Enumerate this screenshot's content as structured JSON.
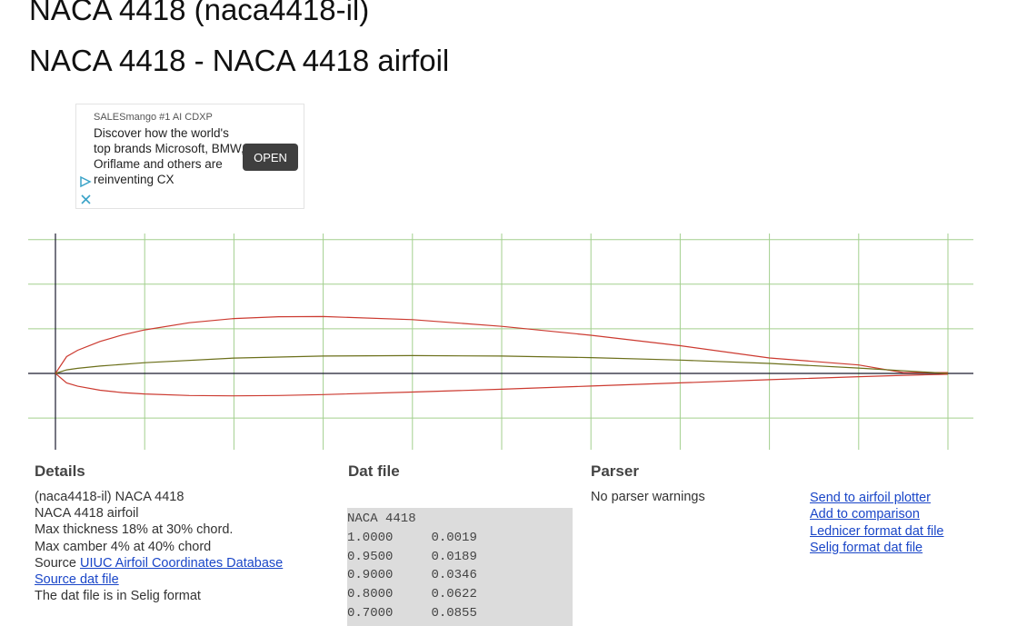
{
  "header": {
    "title": "NACA 4418 (naca4418-il)",
    "subtitle": "NACA 4418 - NACA 4418 airfoil"
  },
  "ad": {
    "sponsor": "SALESmango #1 AI CDXP",
    "text": "Discover how the world's top brands Microsoft, BMW, Oriflame and others are reinventing CX",
    "button": "OPEN",
    "play_icon": "adchoices-triangle-icon",
    "close_icon": "close-x-icon"
  },
  "colors": {
    "surface": "#cc3a30",
    "camber": "#6b6f1a",
    "grid": "#a3cf8e",
    "axis": "#1a1a2e",
    "link": "#1a46c8"
  },
  "chart_data": {
    "type": "line",
    "xlim": [
      0,
      1
    ],
    "ylim": [
      -0.1,
      0.3
    ],
    "grid": true,
    "series": [
      {
        "role": "upper",
        "x": [
          0.0,
          0.0125,
          0.025,
          0.05,
          0.075,
          0.1,
          0.15,
          0.2,
          0.25,
          0.3,
          0.4,
          0.5,
          0.6,
          0.7,
          0.8,
          0.9,
          0.95,
          1.0
        ],
        "y": [
          0.0,
          0.0376,
          0.0519,
          0.0716,
          0.0862,
          0.0976,
          0.1136,
          0.1231,
          0.1271,
          0.1274,
          0.1206,
          0.1054,
          0.0855,
          0.0622,
          0.0346,
          0.0189,
          0.0019,
          0.0019
        ]
      },
      {
        "role": "lower",
        "x": [
          0.0,
          0.0125,
          0.025,
          0.05,
          0.075,
          0.1,
          0.15,
          0.2,
          0.25,
          0.3,
          0.4,
          0.5,
          0.6,
          0.7,
          0.8,
          0.9,
          0.95,
          1.0
        ],
        "y": [
          0.0,
          -0.0211,
          -0.0287,
          -0.0377,
          -0.043,
          -0.046,
          -0.0495,
          -0.0503,
          -0.0494,
          -0.0474,
          -0.0418,
          -0.0354,
          -0.0284,
          -0.0212,
          -0.0141,
          -0.0074,
          -0.0043,
          -0.0019
        ]
      },
      {
        "role": "camber",
        "x": [
          0.0,
          0.0125,
          0.025,
          0.05,
          0.1,
          0.2,
          0.3,
          0.4,
          0.5,
          0.6,
          0.7,
          0.8,
          0.9,
          1.0
        ],
        "y": [
          0.0,
          0.008,
          0.0115,
          0.0165,
          0.024,
          0.0345,
          0.039,
          0.04,
          0.039,
          0.0355,
          0.03,
          0.0225,
          0.012,
          0.0
        ]
      }
    ]
  },
  "details": {
    "heading": "Details",
    "lines": [
      "(naca4418-il) NACA 4418",
      "NACA 4418 airfoil",
      "Max thickness 18% at 30% chord.",
      "Max camber 4% at 40% chord"
    ],
    "source_prefix": "Source ",
    "source_link": "UIUC Airfoil Coordinates Database",
    "dat_link": "Source dat file",
    "format_note": "The dat file is in Selig format"
  },
  "datfile": {
    "heading": "Dat file",
    "name": "NACA 4418",
    "rows": [
      [
        "1.0000",
        "0.0019"
      ],
      [
        "0.9500",
        "0.0189"
      ],
      [
        "0.9000",
        "0.0346"
      ],
      [
        "0.8000",
        "0.0622"
      ],
      [
        "0.7000",
        "0.0855"
      ]
    ]
  },
  "parser": {
    "heading": "Parser",
    "message": "No parser warnings"
  },
  "links": [
    "Send to airfoil plotter",
    "Add to comparison",
    "Lednicer format dat file",
    "Selig format dat file"
  ]
}
